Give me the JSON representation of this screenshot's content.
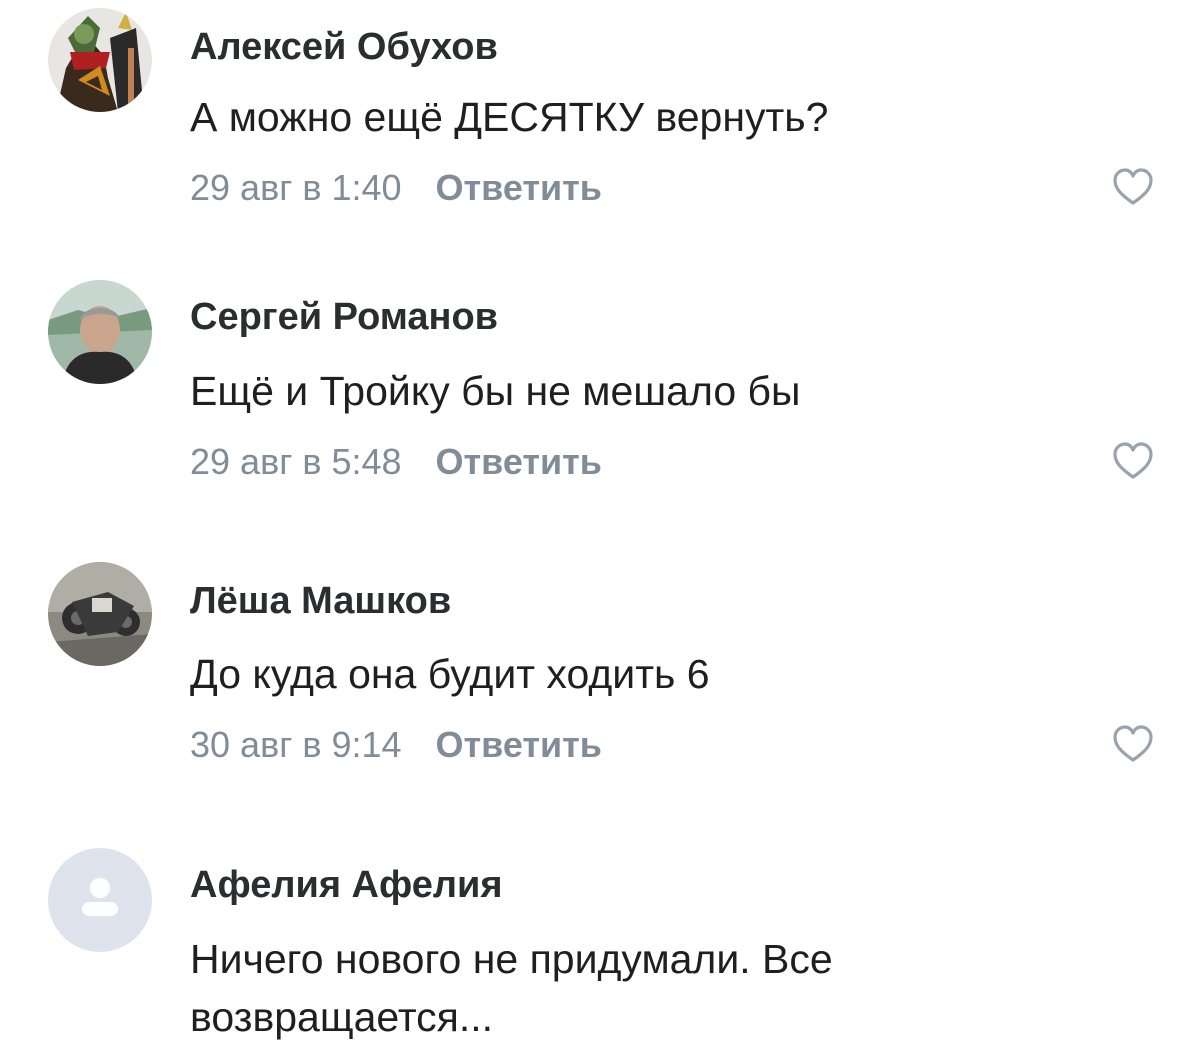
{
  "comments": [
    {
      "author": "Алексей Обухов",
      "text": "А можно ещё ДЕСЯТКУ вернуть?",
      "date": "29 авг в 1:40",
      "reply_label": "Ответить",
      "like_icon": "heart-outline-icon"
    },
    {
      "author": "Сергей Романов",
      "text": "Ещё и Тройку бы не мешало бы",
      "date": "29 авг в 5:48",
      "reply_label": "Ответить",
      "like_icon": "heart-outline-icon"
    },
    {
      "author": "Лёша Машков",
      "text": "До куда она будит ходить 6",
      "date": "30 авг в 9:14",
      "reply_label": "Ответить",
      "like_icon": "heart-outline-icon"
    },
    {
      "author": "Афелия Афелия",
      "text": "Ничего нового не придумали. Все возвращается...",
      "avatar_icon": "default-user-icon"
    }
  ],
  "colors": {
    "meta_text": "#818c99",
    "placeholder_avatar_bg": "#dfe3ee",
    "placeholder_avatar_icon": "#ffffff"
  }
}
